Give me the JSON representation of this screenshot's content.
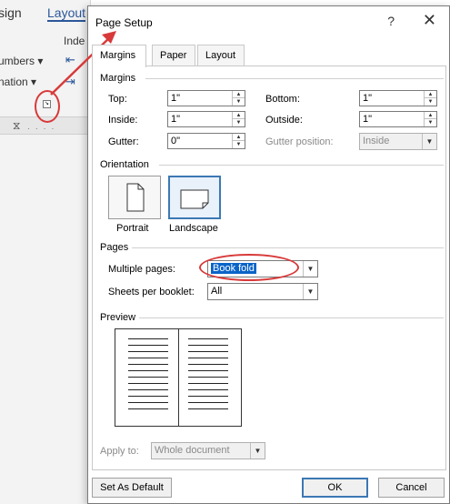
{
  "ribbon": {
    "tab_design": "sign",
    "tab_layout": "Layout",
    "indent": "Inde",
    "line_numbers": "umbers ▾",
    "hyphenation": "nation ▾"
  },
  "dialog": {
    "title": "Page Setup",
    "help": "?",
    "close": "✕",
    "tabs": [
      "Margins",
      "Paper",
      "Layout"
    ],
    "margins": {
      "section": "Margins",
      "top_label": "Top:",
      "top_value": "1\"",
      "bottom_label": "Bottom:",
      "bottom_value": "1\"",
      "inside_label": "Inside:",
      "inside_value": "1\"",
      "outside_label": "Outside:",
      "outside_value": "1\"",
      "gutter_label": "Gutter:",
      "gutter_value": "0\"",
      "gutter_position_label": "Gutter position:",
      "gutter_position_value": "Inside"
    },
    "orientation": {
      "section": "Orientation",
      "portrait": "Portrait",
      "landscape": "Landscape"
    },
    "pages": {
      "section": "Pages",
      "multiple_pages_label": "Multiple pages:",
      "multiple_pages_value": "Book fold",
      "sheets_label": "Sheets per booklet:",
      "sheets_value": "All"
    },
    "preview": {
      "section": "Preview",
      "apply_to_label": "Apply to:",
      "apply_to_value": "Whole document"
    },
    "buttons": {
      "set_default": "Set As Default",
      "ok": "OK",
      "cancel": "Cancel"
    }
  },
  "colors": {
    "annotation": "#d83a3a",
    "selection": "#0a64c8",
    "accent": "#3c78b4"
  }
}
